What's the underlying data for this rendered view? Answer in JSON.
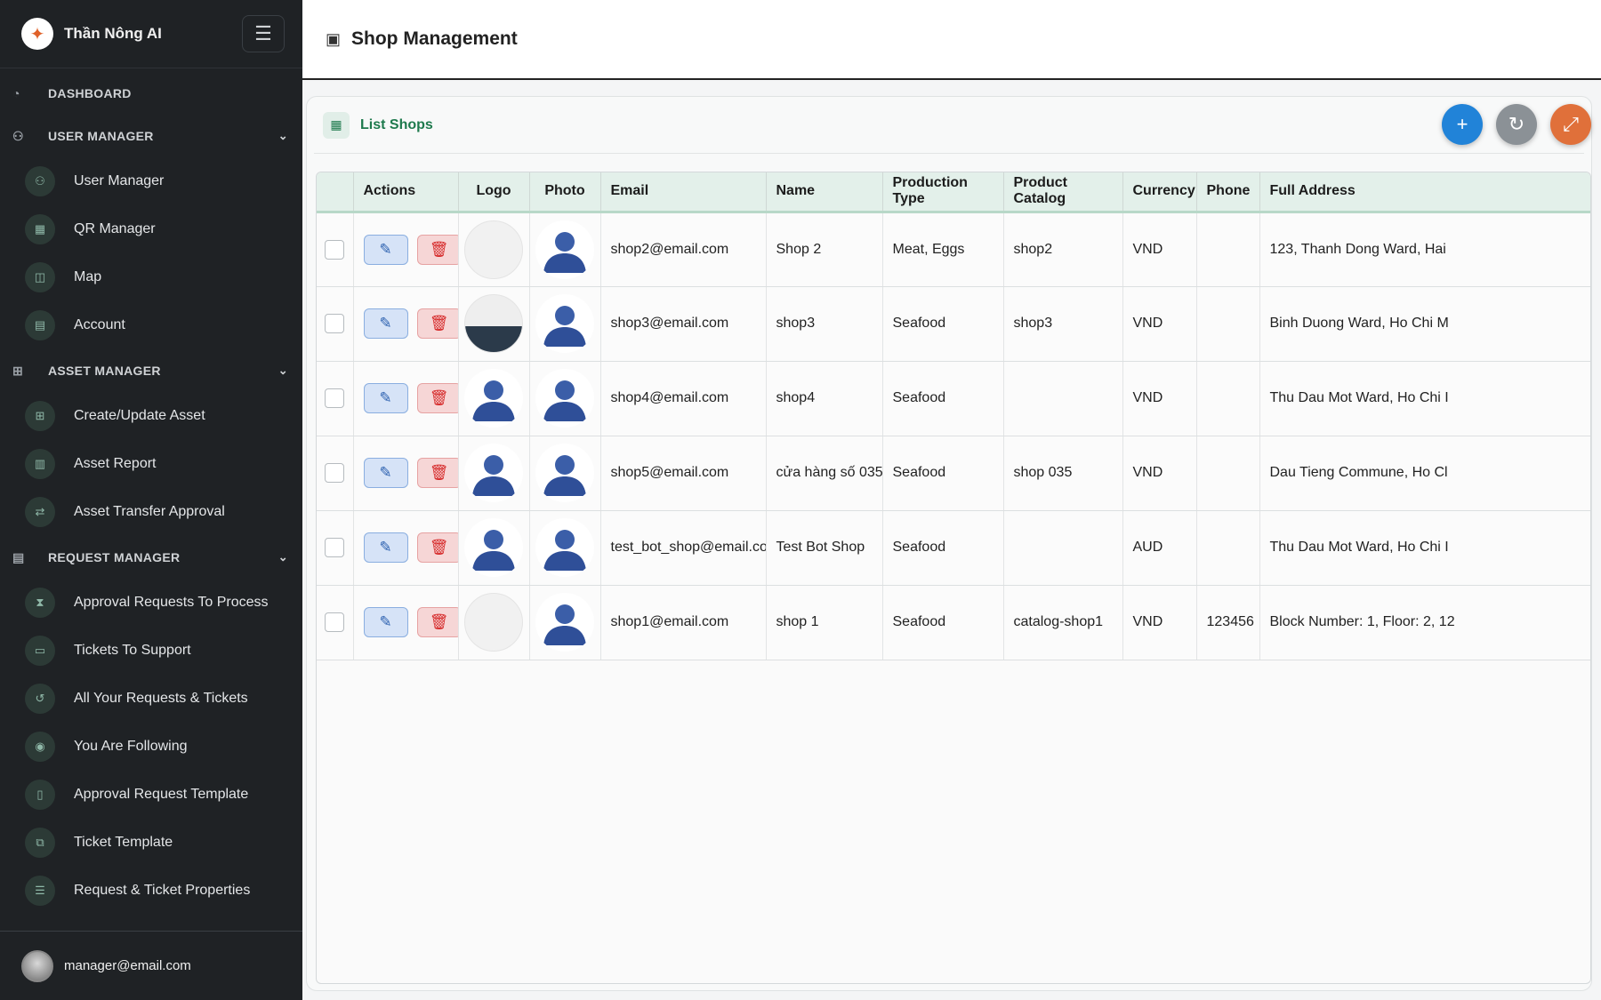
{
  "brand": {
    "name": "Thần Nông AI"
  },
  "header": {
    "title": "Shop Management"
  },
  "sidebar": {
    "groups": [
      {
        "label": "DASHBOARD"
      },
      {
        "label": "USER MANAGER",
        "items": [
          {
            "label": "User Manager"
          },
          {
            "label": "QR Manager"
          },
          {
            "label": "Map"
          },
          {
            "label": "Account"
          }
        ]
      },
      {
        "label": "ASSET MANAGER",
        "items": [
          {
            "label": "Create/Update Asset"
          },
          {
            "label": "Asset Report"
          },
          {
            "label": "Asset Transfer Approval"
          }
        ]
      },
      {
        "label": "REQUEST MANAGER",
        "items": [
          {
            "label": "Approval Requests To Process"
          },
          {
            "label": "Tickets To Support"
          },
          {
            "label": "All Your Requests & Tickets"
          },
          {
            "label": "You Are Following"
          },
          {
            "label": "Approval Request Template"
          },
          {
            "label": "Ticket Template"
          },
          {
            "label": "Request & Ticket Properties"
          }
        ]
      }
    ]
  },
  "user": {
    "email": "manager@email.com"
  },
  "card": {
    "title": "List Shops"
  },
  "table": {
    "columns": [
      "",
      "Actions",
      "Logo",
      "Photo",
      "Email",
      "Name",
      "Production Type",
      "Product Catalog",
      "Currency",
      "Phone",
      "Full Address"
    ],
    "rows": [
      {
        "email": "shop2@email.com",
        "name": "Shop 2",
        "production_type": "Meat, Eggs",
        "catalog": "shop2",
        "currency": "VND",
        "phone": "",
        "address": "123, Thanh Dong Ward, Hai"
      },
      {
        "email": "shop3@email.com",
        "name": "shop3",
        "production_type": "Seafood",
        "catalog": "shop3",
        "currency": "VND",
        "phone": "",
        "address": "Binh Duong Ward, Ho Chi M"
      },
      {
        "email": "shop4@email.com",
        "name": "shop4",
        "production_type": "Seafood",
        "catalog": "",
        "currency": "VND",
        "phone": "",
        "address": "Thu Dau Mot Ward, Ho Chi I"
      },
      {
        "email": "shop5@email.com",
        "name": "cửa hàng số 035",
        "production_type": "Seafood",
        "catalog": "shop 035",
        "currency": "VND",
        "phone": "",
        "address": "Dau Tieng Commune, Ho Cl"
      },
      {
        "email": "test_bot_shop@email.com",
        "name": "Test Bot Shop",
        "production_type": "Seafood",
        "catalog": "",
        "currency": "AUD",
        "phone": "",
        "address": "Thu Dau Mot Ward, Ho Chi I"
      },
      {
        "email": "shop1@email.com",
        "name": "shop 1",
        "production_type": "Seafood",
        "catalog": "catalog-shop1",
        "currency": "VND",
        "phone": "123456",
        "address": "Block Number: 1, Floor: 2, 12"
      }
    ]
  }
}
